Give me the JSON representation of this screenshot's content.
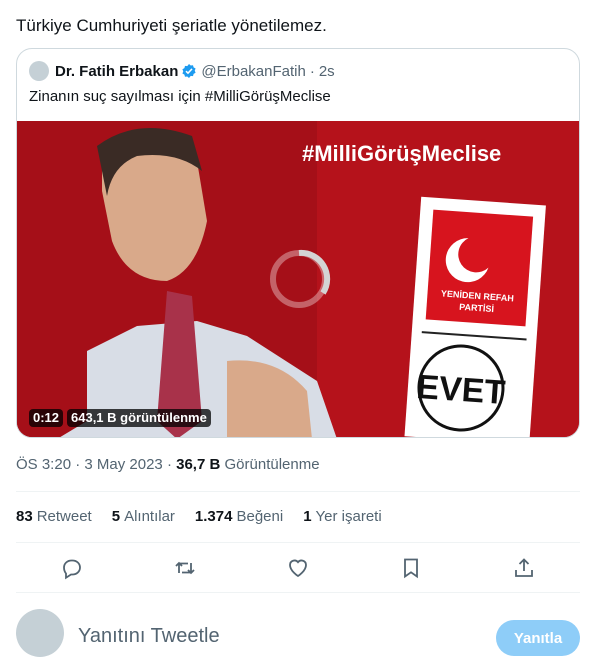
{
  "tweet": {
    "text": "Türkiye Cumhuriyeti şeriatle yönetilemez."
  },
  "quote": {
    "name": "Dr. Fatih Erbakan",
    "handle": "@ErbakanFatih",
    "dot": "·",
    "time": "2s",
    "text": "Zinanın suç sayılması için #MilliGörüşMeclise",
    "media": {
      "hashtag_text": "#MilliGörüşMeclise",
      "logo_line1": "YENİDEN REFAH",
      "logo_line2": "PARTİSİ",
      "ballot_text": "EVET",
      "duration": "0:12",
      "views": "643,1 B görüntülenme"
    }
  },
  "meta": {
    "time": "ÖS 3:20",
    "sep": "·",
    "date": "3 May 2023",
    "views_count": "36,7 B",
    "views_label": "Görüntülenme"
  },
  "stats": {
    "retweets": {
      "count": "83",
      "label": "Retweet"
    },
    "quotes": {
      "count": "5",
      "label": "Alıntılar"
    },
    "likes": {
      "count": "1.374",
      "label": "Beğeni"
    },
    "bookmarks": {
      "count": "1",
      "label": "Yer işareti"
    }
  },
  "reply": {
    "placeholder": "Yanıtını Tweetle",
    "button": "Yanıtla"
  },
  "colors": {
    "accent": "#1d9bf0",
    "red": "#b5121b",
    "button_disabled": "#8ecdf8"
  },
  "icons": [
    "verified-badge-icon",
    "reply-icon",
    "retweet-icon",
    "like-icon",
    "bookmark-icon",
    "share-icon",
    "loading-spinner-icon"
  ]
}
